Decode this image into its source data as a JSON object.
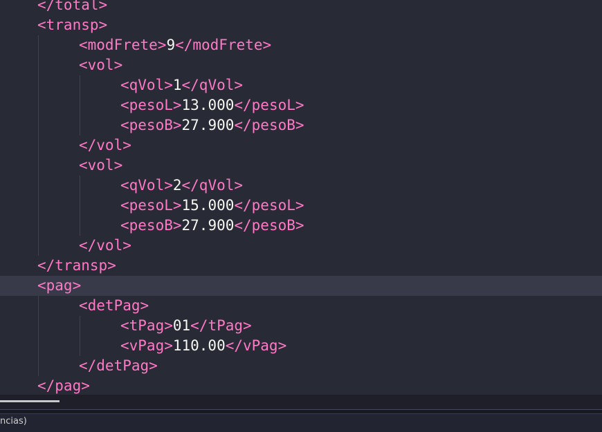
{
  "editor": {
    "lines": [
      {
        "segments": [
          {
            "t": "tag",
            "v": "</total>"
          }
        ]
      },
      {
        "segments": [
          {
            "t": "tag",
            "v": "<transp>"
          }
        ]
      },
      {
        "segments": [
          {
            "t": "tag",
            "v": "<modFrete>"
          },
          {
            "t": "text",
            "v": "9"
          },
          {
            "t": "tag",
            "v": "</modFrete>"
          }
        ]
      },
      {
        "segments": [
          {
            "t": "tag",
            "v": "<vol>"
          }
        ]
      },
      {
        "segments": [
          {
            "t": "tag",
            "v": "<qVol>"
          },
          {
            "t": "text",
            "v": "1"
          },
          {
            "t": "tag",
            "v": "</qVol>"
          }
        ]
      },
      {
        "segments": [
          {
            "t": "tag",
            "v": "<pesoL>"
          },
          {
            "t": "text",
            "v": "13.000"
          },
          {
            "t": "tag",
            "v": "</pesoL>"
          }
        ]
      },
      {
        "segments": [
          {
            "t": "tag",
            "v": "<pesoB>"
          },
          {
            "t": "text",
            "v": "27.900"
          },
          {
            "t": "tag",
            "v": "</pesoB>"
          }
        ]
      },
      {
        "segments": [
          {
            "t": "tag",
            "v": "</vol>"
          }
        ]
      },
      {
        "segments": [
          {
            "t": "tag",
            "v": "<vol>"
          }
        ]
      },
      {
        "segments": [
          {
            "t": "tag",
            "v": "<qVol>"
          },
          {
            "t": "text",
            "v": "2"
          },
          {
            "t": "tag",
            "v": "</qVol>"
          }
        ]
      },
      {
        "segments": [
          {
            "t": "tag",
            "v": "<pesoL>"
          },
          {
            "t": "text",
            "v": "15.000"
          },
          {
            "t": "tag",
            "v": "</pesoL>"
          }
        ]
      },
      {
        "segments": [
          {
            "t": "tag",
            "v": "<pesoB>"
          },
          {
            "t": "text",
            "v": "27.900"
          },
          {
            "t": "tag",
            "v": "</pesoB>"
          }
        ]
      },
      {
        "segments": [
          {
            "t": "tag",
            "v": "</vol>"
          }
        ]
      },
      {
        "segments": [
          {
            "t": "tag",
            "v": "</transp>"
          }
        ]
      },
      {
        "segments": [
          {
            "t": "tag",
            "v": "<pag>"
          }
        ]
      },
      {
        "segments": [
          {
            "t": "tag",
            "v": "<detPag>"
          }
        ]
      },
      {
        "segments": [
          {
            "t": "tag",
            "v": "<tPag>"
          },
          {
            "t": "text",
            "v": "01"
          },
          {
            "t": "tag",
            "v": "</tPag>"
          }
        ]
      },
      {
        "segments": [
          {
            "t": "tag",
            "v": "<vPag>"
          },
          {
            "t": "text",
            "v": "110.00"
          },
          {
            "t": "tag",
            "v": "</vPag>"
          }
        ]
      },
      {
        "segments": [
          {
            "t": "tag",
            "v": "</detPag>"
          }
        ]
      },
      {
        "segments": [
          {
            "t": "tag",
            "v": "</pag>"
          }
        ]
      }
    ]
  },
  "status_bar": {
    "text": "ncias)"
  },
  "colors": {
    "background": "#282a36",
    "tag": "#ff79c6",
    "text": "#f8f8f2",
    "current_line": "#383a49"
  }
}
